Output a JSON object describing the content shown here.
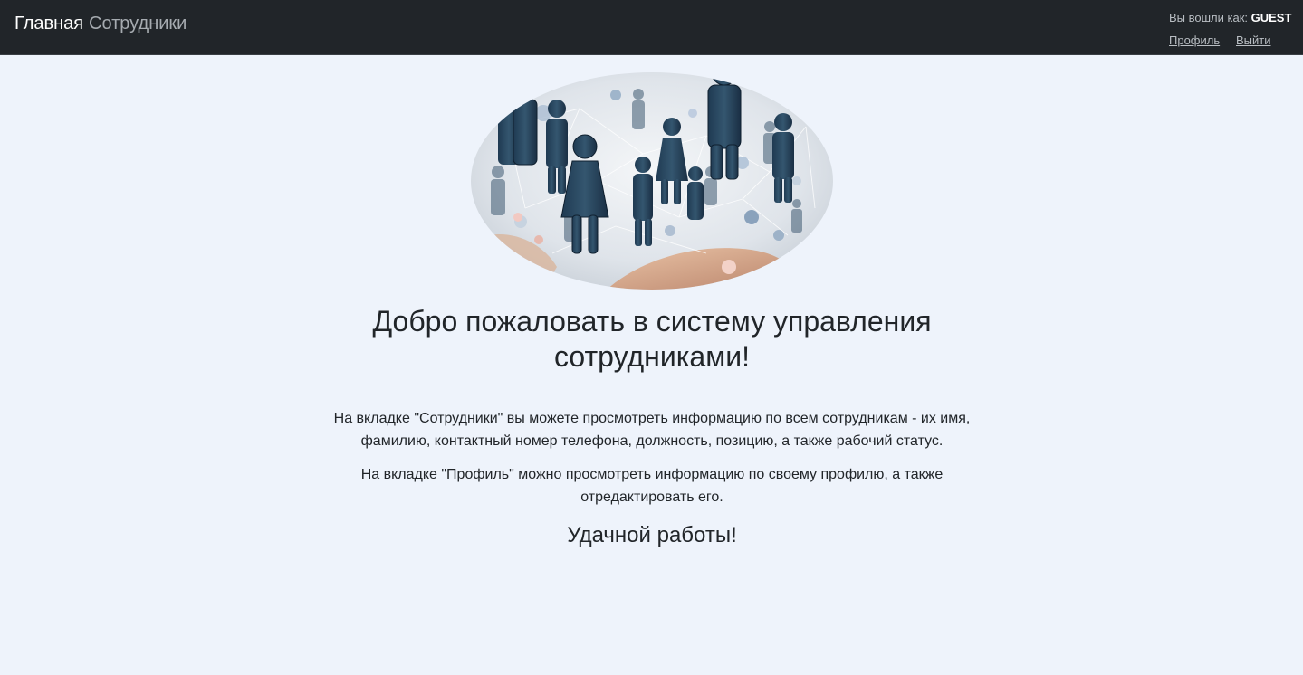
{
  "navbar": {
    "brand": "Главная",
    "links": [
      {
        "label": "Сотрудники"
      }
    ],
    "user": {
      "logged_in_label": "Вы вошли как:",
      "username": "GUEST",
      "profile_link": "Профиль",
      "logout_link": "Выйти"
    }
  },
  "hero": {
    "image_icon": "people-network-image"
  },
  "main": {
    "title": "Добро пожаловать в систему управления сотрудниками!",
    "paragraphs": [
      "На вкладке \"Сотрудники\" вы можете просмотреть информацию по всем сотрудникам - их имя, фамилию, контактный номер телефона, должность, позицию, а также рабочий статус.",
      "На вкладке \"Профиль\" можно просмотреть информацию по своему профилю, а также отредактировать его."
    ],
    "closing": "Удачной работы!"
  },
  "colors": {
    "navbar_bg": "#212529",
    "page_bg": "#eef3fb",
    "text": "#212529",
    "nav_muted": "#a6abb0"
  }
}
